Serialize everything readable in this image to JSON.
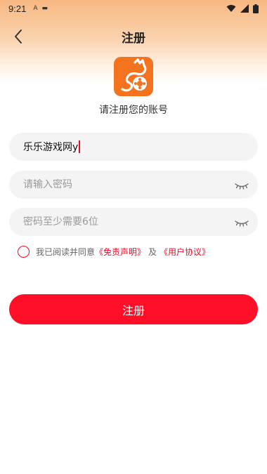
{
  "status_bar": {
    "time": "9:21",
    "mini_icons": [
      "A",
      "▬"
    ]
  },
  "header": {
    "title": "注册"
  },
  "logo": {
    "subtitle": "请注册您的账号"
  },
  "form": {
    "username": {
      "value": "乐乐游戏网y",
      "placeholder": ""
    },
    "password": {
      "value": "",
      "placeholder": "请输入密码"
    },
    "password_hint": {
      "value": "",
      "placeholder": "密码至少需要6位"
    }
  },
  "agreement": {
    "prefix": "我已阅读并同意",
    "disclaimer_link": "《免责声明》",
    "connector": "及",
    "user_agreement_link": "《用户协议》"
  },
  "register_button": {
    "label": "注册"
  },
  "colors": {
    "accent": "#fe0f27",
    "logo_orange": "#f4731f",
    "field_bg": "#f4f4f4"
  }
}
